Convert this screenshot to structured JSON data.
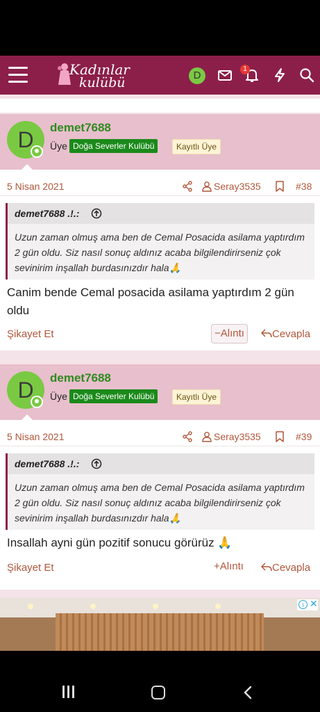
{
  "header": {
    "logo_line1": "Kadınlar",
    "logo_line2": "kulübü",
    "avatar_letter": "D",
    "notification_count": "1",
    "icons": [
      "menu-icon",
      "mail-icon",
      "bell-icon",
      "lightning-icon",
      "search-icon"
    ],
    "brand_color": "#8c1f4a"
  },
  "posts": [
    {
      "avatar_letter": "D",
      "username": "demet7688",
      "role": "Üye",
      "badge_club": "Doğa Severler Kulübü",
      "badge_member": "Kayıtlı Üye",
      "date": "5 Nisan 2021",
      "quoted_user": "Seray3535",
      "post_number": "#38",
      "quote_author": "demet7688 .!.:",
      "quote_text": "Uzun zaman olmuş ama ben de Cemal Posacida asilama yaptırdım 2 gün oldu. Siz nasıl sonuç aldınız acaba bilgilendirirseniz çok sevinirim inşallah burdasınızdır hala🙏",
      "body": "Canim bende Cemal posacida asilama yaptırdım 2 gün oldu",
      "report_label": "Şikayet Et",
      "quote_label": "Alıntı",
      "quote_sign": "−",
      "reply_label": "Cevapla"
    },
    {
      "avatar_letter": "D",
      "username": "demet7688",
      "role": "Üye",
      "badge_club": "Doğa Severler Kulübü",
      "badge_member": "Kayıtlı Üye",
      "date": "5 Nisan 2021",
      "quoted_user": "Seray3535",
      "post_number": "#39",
      "quote_author": "demet7688 .!.:",
      "quote_text": "Uzun zaman olmuş ama ben de Cemal Posacida asilama yaptırdım 2 gün oldu. Siz nasıl sonuç aldınız acaba bilgilendirirseniz çok sevinirim inşallah burdasınızdır hala🙏",
      "body": "Insallah ayni gün pozitif sonucu görürüz 🙏",
      "report_label": "Şikayet Et",
      "quote_label": "Alıntı",
      "quote_sign": "+",
      "reply_label": "Cevapla"
    }
  ],
  "ad": {
    "info_label": "i",
    "close_label": "✕"
  }
}
